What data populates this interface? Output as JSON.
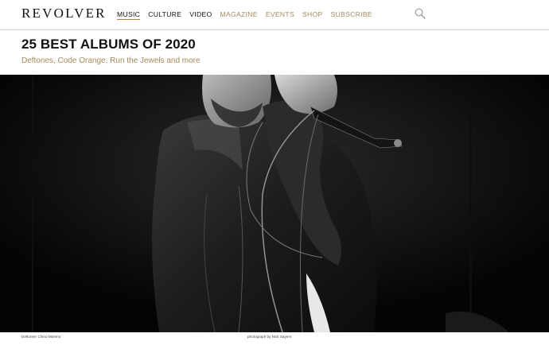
{
  "brand": {
    "logo": "REVOLVER"
  },
  "nav": {
    "items": [
      {
        "label": "MUSIC",
        "style": "dark",
        "active": true
      },
      {
        "label": "CULTURE",
        "style": "dark",
        "active": false
      },
      {
        "label": "VIDEO",
        "style": "dark",
        "active": false
      },
      {
        "label": "MAGAZINE",
        "style": "gold",
        "active": false
      },
      {
        "label": "EVENTS",
        "style": "gold",
        "active": false
      },
      {
        "label": "SHOP",
        "style": "gold",
        "active": false
      },
      {
        "label": "SUBSCRIBE",
        "style": "gold",
        "active": false
      }
    ],
    "search_icon": "search-icon"
  },
  "article": {
    "title": "25 BEST ALBUMS OF 2020",
    "subtitle": "Deftones, Code Orange, Run the Jewels and more"
  },
  "hero": {
    "caption_left": "Deftones' Chino Moreno",
    "caption_right": "photograph by Nick Sayers"
  },
  "colors": {
    "accent_gold": "#a48a5c",
    "text_dark": "#111111",
    "hero_bg": "#040404"
  }
}
